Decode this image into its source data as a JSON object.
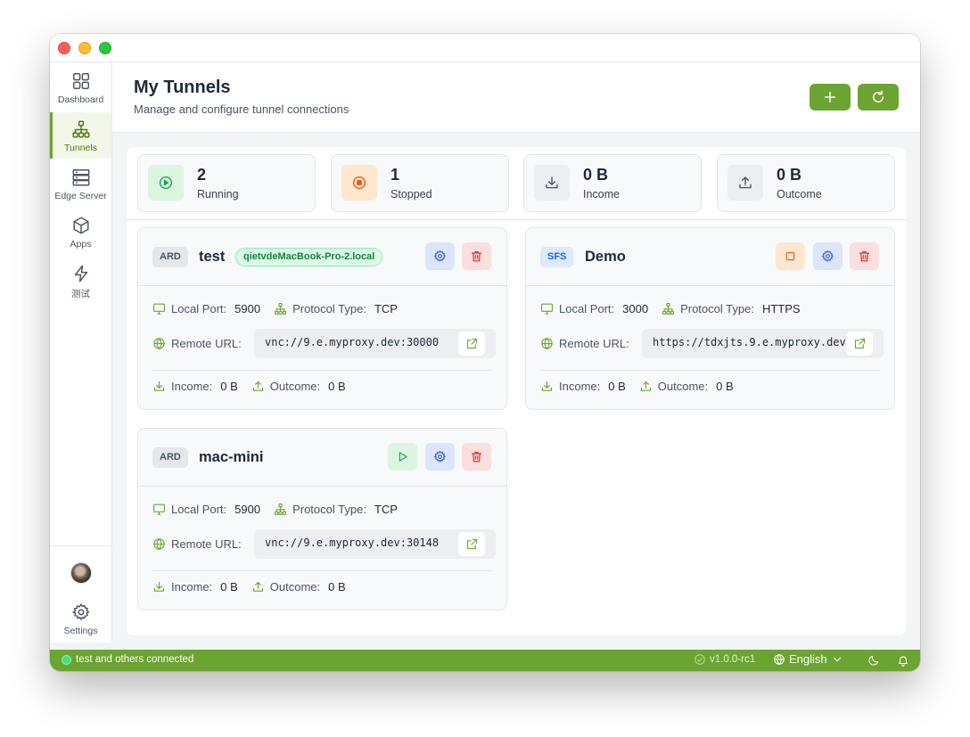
{
  "app": {
    "colors": {
      "accent": "#6ba431",
      "accent_dark": "#4d7c0f",
      "bg": "#f3f4f6"
    }
  },
  "sidebar": {
    "items": [
      {
        "label": "Dashboard",
        "icon": "grid-icon",
        "active": false
      },
      {
        "label": "Tunnels",
        "icon": "network-icon",
        "active": true
      },
      {
        "label": "Edge Server",
        "icon": "server-icon",
        "active": false
      },
      {
        "label": "Apps",
        "icon": "cube-icon",
        "active": false
      },
      {
        "label": "测试",
        "icon": "bolt-icon",
        "active": false
      }
    ],
    "settings_label": "Settings"
  },
  "header": {
    "title": "My Tunnels",
    "subtitle": "Manage and configure tunnel connections"
  },
  "stats": [
    {
      "value": "2",
      "label": "Running",
      "icon": "play-circle-icon"
    },
    {
      "value": "1",
      "label": "Stopped",
      "icon": "stop-circle-icon"
    },
    {
      "value": "0 B",
      "label": "Income",
      "icon": "download-icon"
    },
    {
      "value": "0 B",
      "label": "Outcome",
      "icon": "upload-icon"
    }
  ],
  "labels": {
    "local_port": "Local Port:",
    "protocol": "Protocol Type:",
    "remote_url": "Remote URL:",
    "income": "Income:",
    "outcome": "Outcome:"
  },
  "tunnels": [
    {
      "type": "ARD",
      "name": "test",
      "host": "qietvdeMacBook-Pro-2.local",
      "local_port": "5900",
      "protocol": "TCP",
      "remote_url": "vnc://9.e.myproxy.dev:30000",
      "income": "0 B",
      "outcome": "0 B"
    },
    {
      "type": "SFS",
      "name": "Demo",
      "local_port": "3000",
      "protocol": "HTTPS",
      "remote_url": "https://tdxjts.9.e.myproxy.dev",
      "income": "0 B",
      "outcome": "0 B"
    },
    {
      "type": "ARD",
      "name": "mac-mini",
      "local_port": "5900",
      "protocol": "TCP",
      "remote_url": "vnc://9.e.myproxy.dev:30148",
      "income": "0 B",
      "outcome": "0 B"
    }
  ],
  "statusbar": {
    "message": "test and others connected",
    "version": "v1.0.0-rc1",
    "language": "English"
  }
}
